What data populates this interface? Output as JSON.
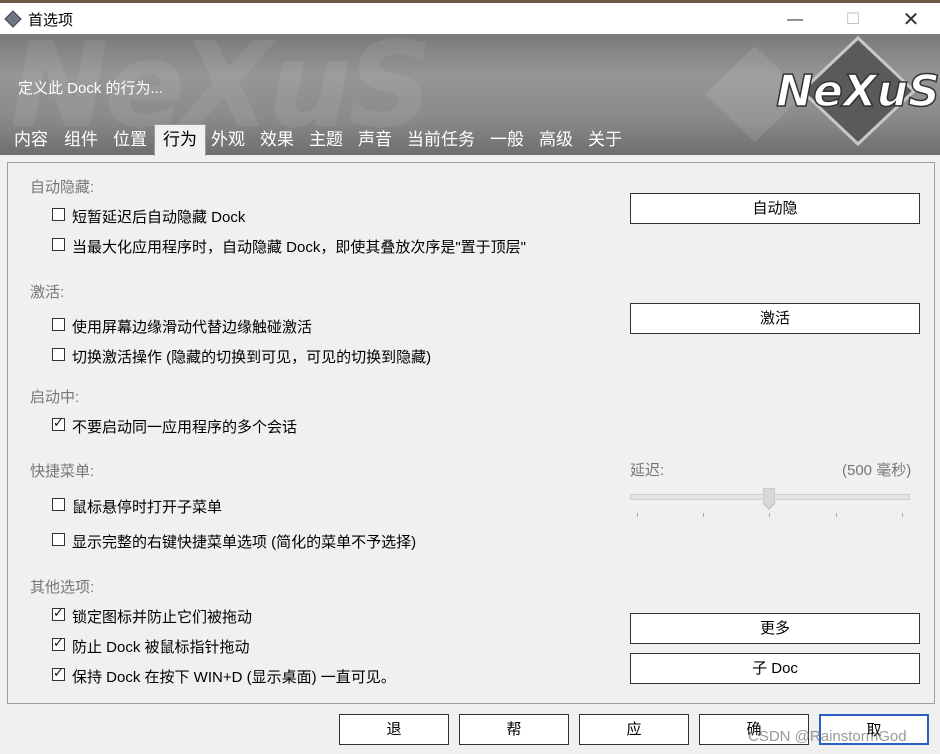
{
  "window": {
    "title": "首选项",
    "min_glyph": "—",
    "max_glyph": "☐",
    "close_glyph": "✕"
  },
  "banner": {
    "subtitle": "定义此 Dock 的行为...",
    "logo_text": "NeXuS",
    "bg_text": "NeXuS"
  },
  "tabs": [
    {
      "label": "内容",
      "active": false
    },
    {
      "label": "组件",
      "active": false
    },
    {
      "label": "位置",
      "active": false
    },
    {
      "label": "行为",
      "active": true
    },
    {
      "label": "外观",
      "active": false
    },
    {
      "label": "效果",
      "active": false
    },
    {
      "label": "主题",
      "active": false
    },
    {
      "label": "声音",
      "active": false
    },
    {
      "label": "当前任务",
      "active": false
    },
    {
      "label": "一般",
      "active": false
    },
    {
      "label": "高级",
      "active": false
    },
    {
      "label": "关于",
      "active": false
    }
  ],
  "sections": {
    "autohide": {
      "title": "自动隐藏:",
      "options": [
        {
          "label": "短暂延迟后自动隐藏 Dock",
          "checked": false
        },
        {
          "label": "当最大化应用程序时，自动隐藏 Dock，即使其叠放次序是\"置于顶层\"",
          "checked": false
        }
      ],
      "button": "自动隐"
    },
    "activation": {
      "title": "激活:",
      "options": [
        {
          "label": "使用屏幕边缘滑动代替边缘触碰激活",
          "checked": false
        },
        {
          "label": "切换激活操作 (隐藏的切换到可见，可见的切换到隐藏)",
          "checked": false
        }
      ],
      "button": "激活"
    },
    "launching": {
      "title": "启动中:",
      "options": [
        {
          "label": "不要启动同一应用程序的多个会话",
          "checked": true
        }
      ]
    },
    "quickmenu": {
      "title": "快捷菜单:",
      "options": [
        {
          "label": "鼠标悬停时打开子菜单",
          "checked": false
        },
        {
          "label": "显示完整的右键快捷菜单选项 (简化的菜单不予选择)",
          "checked": false
        }
      ],
      "delay_label": "延迟:",
      "delay_value": "(500 毫秒)",
      "delay_ms": 500
    },
    "other": {
      "title": "其他选项:",
      "options": [
        {
          "label": "锁定图标并防止它们被拖动",
          "checked": true
        },
        {
          "label": "防止 Dock 被鼠标指针拖动",
          "checked": true
        },
        {
          "label": "保持 Dock 在按下 WIN+D (显示桌面) 一直可见。",
          "checked": true
        }
      ],
      "buttons": [
        "更多",
        "子 Doc"
      ]
    }
  },
  "footer": {
    "buttons": [
      "退",
      "帮",
      "应",
      "确",
      "取"
    ]
  },
  "watermark": "CSDN @RainstormGod",
  "colors": {
    "section_title": "#777777",
    "banner": "#8a8a8a",
    "border": "#333333"
  }
}
